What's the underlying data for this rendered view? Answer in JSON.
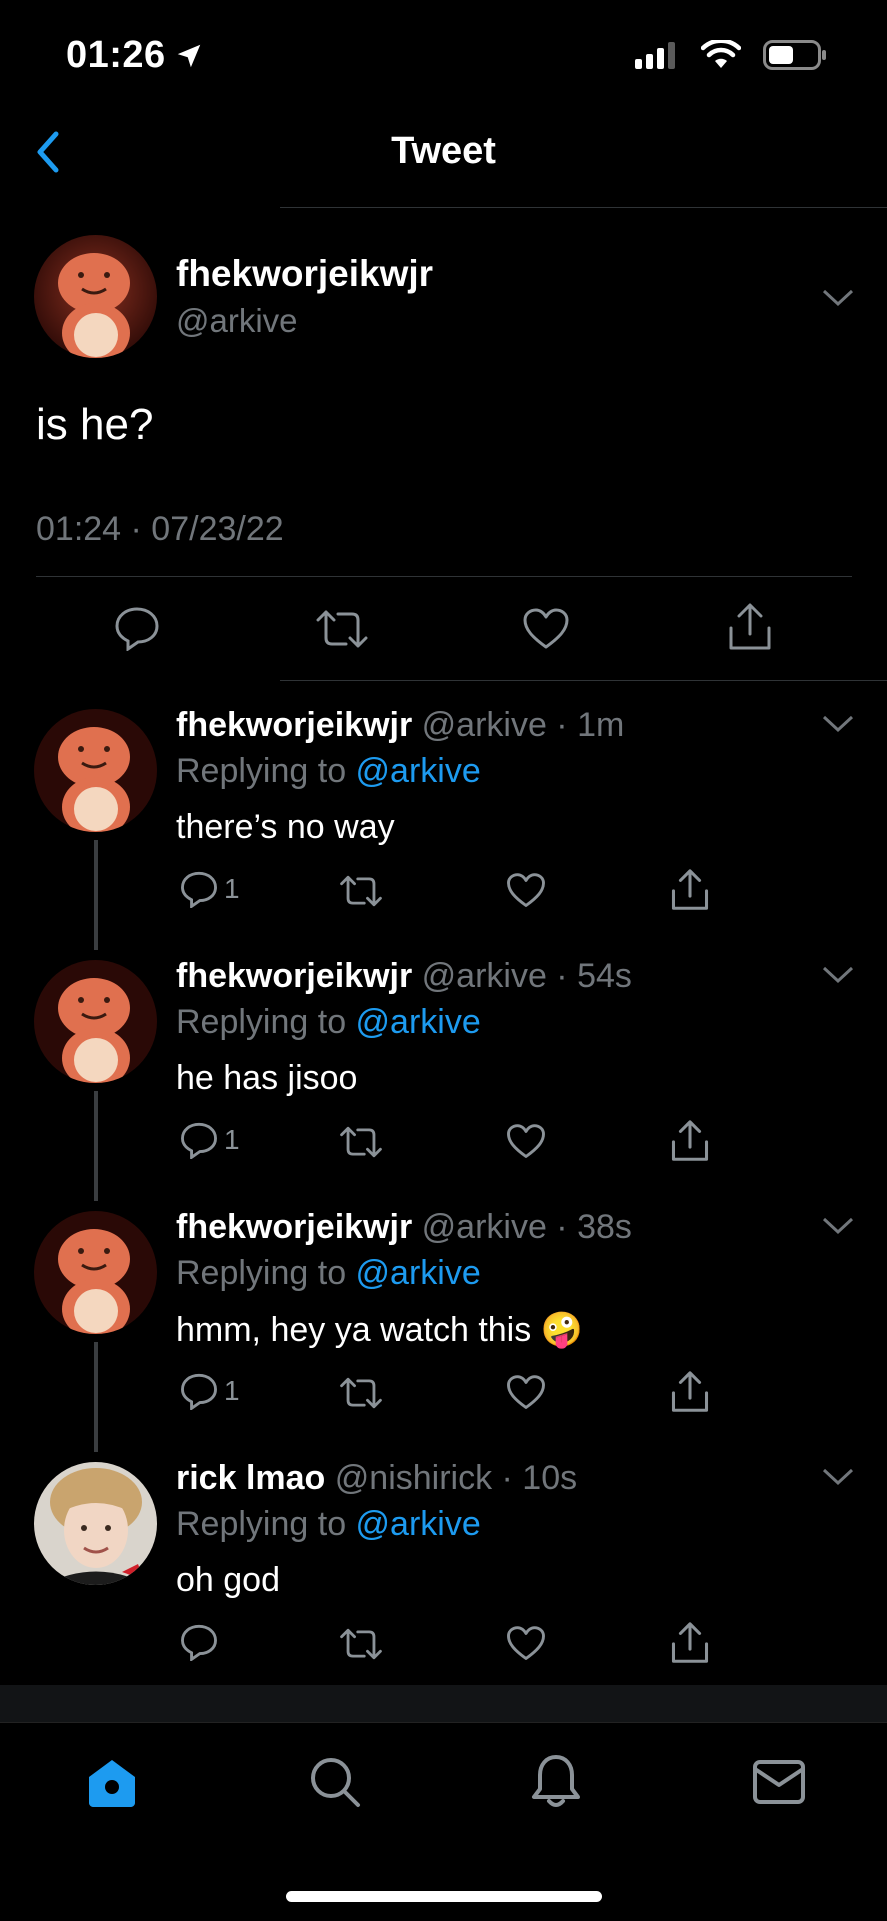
{
  "status": {
    "time": "01:26"
  },
  "nav": {
    "title": "Tweet"
  },
  "main_tweet": {
    "name": "fhekworjeikwjr",
    "handle": "@arkive",
    "text": "is he?",
    "timestamp": "01:24 · 07/23/22"
  },
  "replies": [
    {
      "name": "fhekworjeikwjr",
      "meta": "@arkive · 1m",
      "replying_prefix": "Replying to ",
      "replying_handle": "@arkive",
      "text": "there’s no way",
      "reply_count": "1"
    },
    {
      "name": "fhekworjeikwjr",
      "meta": "@arkive · 54s",
      "replying_prefix": "Replying to ",
      "replying_handle": "@arkive",
      "text": "he has jisoo",
      "reply_count": "1"
    },
    {
      "name": "fhekworjeikwjr",
      "meta": "@arkive · 38s",
      "replying_prefix": "Replying to ",
      "replying_handle": "@arkive",
      "text": "hmm, hey ya watch this 🤪",
      "reply_count": "1"
    },
    {
      "name": "rick lmao",
      "meta": "@nishirick · 10s",
      "replying_prefix": "Replying to ",
      "replying_handle": "@arkive",
      "text": "oh god",
      "reply_count": ""
    }
  ],
  "tabs": [
    {
      "icon": "home-icon",
      "active": true
    },
    {
      "icon": "search-icon",
      "active": false
    },
    {
      "icon": "bell-icon",
      "active": false
    },
    {
      "icon": "mail-icon",
      "active": false
    }
  ],
  "colors": {
    "accent": "#1d9bf0",
    "muted": "#71767b",
    "background": "#000000"
  }
}
